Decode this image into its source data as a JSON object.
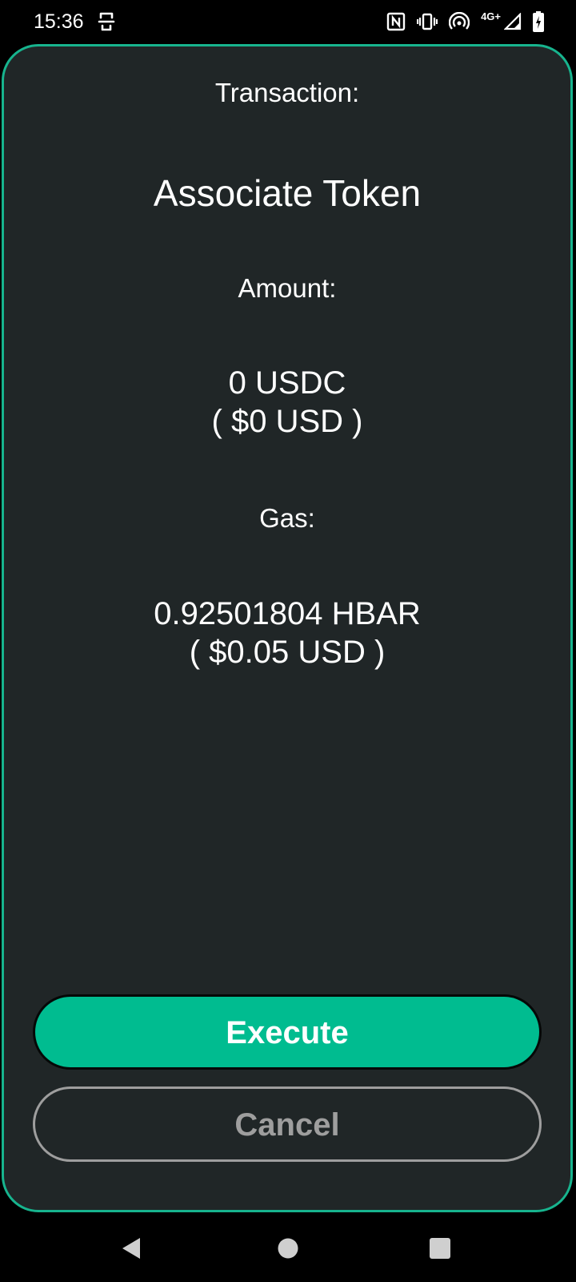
{
  "status_bar": {
    "time": "15:36",
    "network_label": "4G+"
  },
  "transaction": {
    "label": "Transaction:",
    "name": "Associate Token"
  },
  "amount": {
    "label": "Amount:",
    "value": "0 USDC",
    "usd": "( $0 USD )"
  },
  "gas": {
    "label": "Gas:",
    "value": "0.92501804 HBAR",
    "usd": "( $0.05 USD )"
  },
  "actions": {
    "execute_label": "Execute",
    "cancel_label": "Cancel"
  },
  "icons": {
    "status_left": "keyboard-shortcut-icon",
    "nfc": "nfc-icon",
    "vibrate": "vibrate-icon",
    "hotspot": "hotspot-icon",
    "signal": "signal-icon",
    "battery": "battery-charging-icon",
    "nav_back": "back-icon",
    "nav_home": "home-icon",
    "nav_recents": "recents-icon"
  },
  "colors": {
    "accent": "#00bc90",
    "card_background": "#202627",
    "card_border": "#17b48e",
    "cancel_border": "#9e9e9e"
  }
}
